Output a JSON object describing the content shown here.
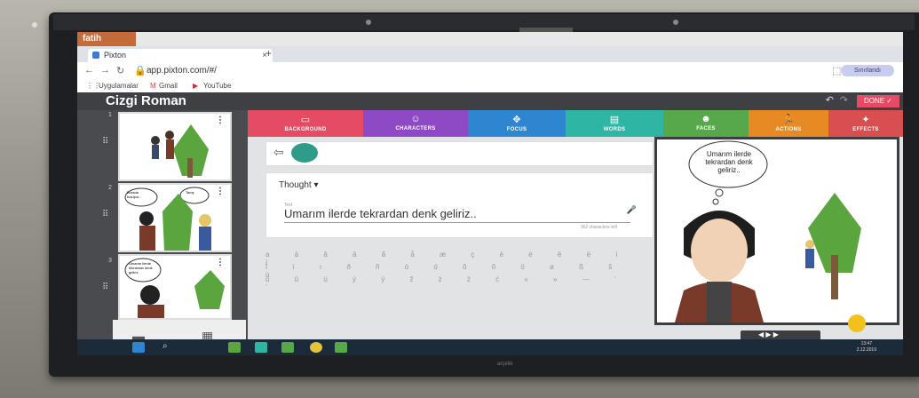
{
  "os_banner": {
    "text": "fatih"
  },
  "browser": {
    "tab_title": "Pixton",
    "tab_close": "×",
    "new_tab": "+",
    "url": "app.pixton.com/#/",
    "extension_badge": "Sınırlandı",
    "bookmarks": [
      "Uygulamalar",
      "Gmail",
      "YouTube"
    ]
  },
  "app": {
    "title": "Cizgi Roman",
    "done_label": "DONE ✓",
    "tools": [
      {
        "label": "BACKGROUND",
        "color": "#e54b63",
        "icon": "image-icon"
      },
      {
        "label": "CHARACTERS",
        "color": "#8e49c4",
        "icon": "face-icon"
      },
      {
        "label": "FOCUS",
        "color": "#2f86d0",
        "icon": "move-icon"
      },
      {
        "label": "WORDS",
        "color": "#2fb5a4",
        "icon": "speech-icon"
      },
      {
        "label": "FACES",
        "color": "#56a84a",
        "icon": "smile-icon"
      },
      {
        "label": "ACTIONS",
        "color": "#e88a24",
        "icon": "run-icon"
      },
      {
        "label": "EFFECTS",
        "color": "#d94e4e",
        "icon": "sparkle-icon"
      }
    ],
    "panels": [
      {
        "number": "1"
      },
      {
        "number": "2",
        "bubbles": [
          "Burada buluşur...",
          "Tanış"
        ]
      },
      {
        "number": "3",
        "bubbles": [
          "Umarım ilerde tekrardan denk geliriz."
        ]
      }
    ],
    "bubble_type": "Thought",
    "text_field_label": "Text",
    "text_value": "Umarım ilerde tekrardan denk geliriz..",
    "chars_left": "362 characters left",
    "special_chars_row1": "a á â ä ã å æ ç è é ê ë ì í",
    "special_chars_row2": "î ï ı ð ñ ò ó ô õ ö ø ß ŝ ù",
    "special_chars_row3": "ú û ü ý ÿ ž ż ź ć « » — ‘ ’",
    "preview_bubble": "Umarım ilerde tekrardan denk geliriz..",
    "prev_nav": "◀ ▶ ▶"
  },
  "taskbar": {
    "time": "13:47",
    "date": "2.12.2019"
  },
  "monitor_brand": "arçelik"
}
